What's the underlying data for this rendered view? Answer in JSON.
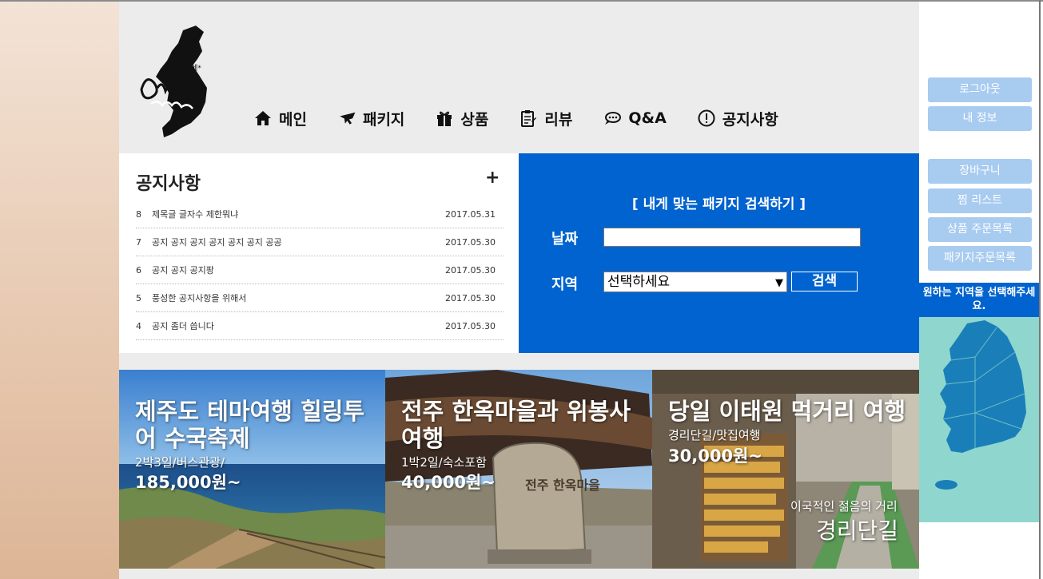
{
  "nav": {
    "items": [
      {
        "icon": "home-icon",
        "label": "메인"
      },
      {
        "icon": "airplane-icon",
        "label": "패키지"
      },
      {
        "icon": "gift-icon",
        "label": "상품"
      },
      {
        "icon": "clipboard-icon",
        "label": "리뷰"
      },
      {
        "icon": "chat-icon",
        "label": "Q&A"
      },
      {
        "icon": "alert-icon",
        "label": "공지사항"
      }
    ]
  },
  "notice": {
    "title": "공지사항",
    "more": "+",
    "rows": [
      {
        "num": "8",
        "subject": "제목글 글자수 제한뭐냐",
        "date": "2017.05.31"
      },
      {
        "num": "7",
        "subject": "공지 공지 공지 공지 공지 공지 공공",
        "date": "2017.05.30"
      },
      {
        "num": "6",
        "subject": "공지 공지 공지팡",
        "date": "2017.05.30"
      },
      {
        "num": "5",
        "subject": "풍성한 공지사항을 위해서",
        "date": "2017.05.30"
      },
      {
        "num": "4",
        "subject": "공지 좀더 씁니다",
        "date": "2017.05.30"
      }
    ]
  },
  "search": {
    "title": "[ 내게 맞는 패키지 검색하기 ]",
    "date_label": "날짜",
    "date_value": "",
    "region_label": "지역",
    "region_selected": "선택하세요",
    "button": "검색"
  },
  "cards": [
    {
      "title": "제주도 테마여행 힐링투어 수국축제",
      "sub": "2박3일/버스관광/",
      "price": "185,000원~"
    },
    {
      "title": "전주 한옥마을과 위봉사 여행",
      "sub": "1박2일/숙소포함",
      "price": "40,000원~",
      "stone_text": "전주 한옥마을"
    },
    {
      "title": "당일 이태원 먹거리 여행",
      "sub": "경리단길/맛집여행",
      "price": "30,000원~",
      "tagline": "이국적인 젊음의 거리",
      "place": "경리단길"
    }
  ],
  "sidebar": {
    "buttons": [
      "로그아웃",
      "내 정보",
      "장바구니",
      "찜 리스트",
      "상품 주문목록",
      "패키지주문목록"
    ],
    "map_title": "원하는 지역을 선택해주세요."
  },
  "colors": {
    "accent_blue": "#0063cf",
    "side_button": "#a8cbf0",
    "map_bg": "#8fd7ce",
    "map_land": "#1a7fb8"
  }
}
